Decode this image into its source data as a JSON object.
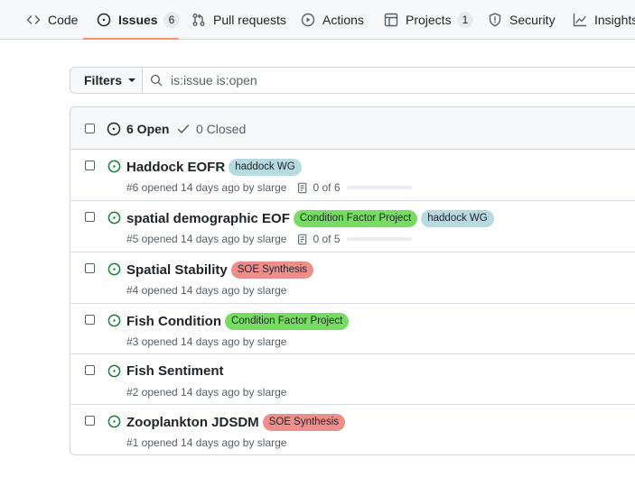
{
  "nav": {
    "tabs": [
      {
        "label": "Code",
        "icon": "code-icon"
      },
      {
        "label": "Issues",
        "icon": "issue-opened-icon",
        "count": "6"
      },
      {
        "label": "Pull requests",
        "icon": "git-pull-request-icon"
      },
      {
        "label": "Actions",
        "icon": "play-icon"
      },
      {
        "label": "Projects",
        "icon": "table-icon",
        "count": "1"
      },
      {
        "label": "Security",
        "icon": "shield-icon"
      },
      {
        "label": "Insights",
        "icon": "graph-icon"
      }
    ],
    "active_tab": "Issues",
    "active_underline_color": "#fd8c73"
  },
  "filters": {
    "button_label": "Filters",
    "search_value": "is:issue is:open"
  },
  "issues_header": {
    "open_label": "6 Open",
    "closed_label": "0 Closed"
  },
  "issues": [
    {
      "title": "Haddock EOFR",
      "number": "#6",
      "meta": "#6 opened 14 days ago by",
      "author": "slarge",
      "labels": [
        {
          "name": "haddock WG",
          "color": "#b7d9e0"
        }
      ],
      "tasks": "0 of 6",
      "progress": 0
    },
    {
      "title": "spatial demographic EOF",
      "number": "#5",
      "meta": "#5 opened 14 days ago by",
      "author": "slarge",
      "labels": [
        {
          "name": "Condition Factor Project",
          "color": "#77dd62"
        },
        {
          "name": "haddock WG",
          "color": "#b7d9e0"
        }
      ],
      "tasks": "0 of 5",
      "progress": 0
    },
    {
      "title": "Spatial Stability",
      "number": "#4",
      "meta": "#4 opened 14 days ago by",
      "author": "slarge",
      "labels": [
        {
          "name": "SOE Synthesis",
          "color": "#ee8e8b"
        }
      ]
    },
    {
      "title": "Fish Condition",
      "number": "#3",
      "meta": "#3 opened 14 days ago by",
      "author": "slarge",
      "labels": [
        {
          "name": "Condition Factor Project",
          "color": "#77dd62"
        }
      ]
    },
    {
      "title": "Fish Sentiment",
      "number": "#2",
      "meta": "#2 opened 14 days ago by",
      "author": "slarge",
      "labels": []
    },
    {
      "title": "Zooplankton JDSDM",
      "number": "#1",
      "meta": "#1 opened 14 days ago by",
      "author": "slarge",
      "labels": [
        {
          "name": "SOE Synthesis",
          "color": "#ee8e8b"
        }
      ]
    }
  ]
}
